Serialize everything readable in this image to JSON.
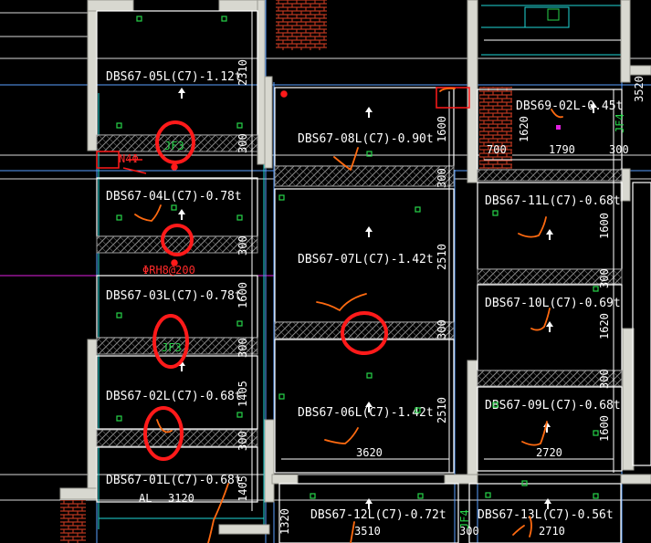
{
  "colors": {
    "background": "#000000",
    "wall": "#d8d8d0",
    "wall_inner": "#2b2b2b",
    "grid_line": "#ffffff",
    "axis_blue": "#5aa0ff",
    "cyan": "#20d8d8",
    "green_marker": "#27d44a",
    "hatch": "#8a8a8a",
    "brick": "#b8361f",
    "markup_red": "#ff1a1a",
    "markup_orange": "#ff6a10",
    "magenta": "#e020e0"
  },
  "slabs": [
    {
      "id": "s05",
      "label": "DBS67-05L(C7)-1.12t"
    },
    {
      "id": "s04",
      "label": "DBS67-04L(C7)-0.78t"
    },
    {
      "id": "s03",
      "label": "DBS67-03L(C7)-0.78t"
    },
    {
      "id": "s02",
      "label": "DBS67-02L(C7)-0.68t"
    },
    {
      "id": "s01",
      "label": "DBS67-01L(C7)-0.68t"
    },
    {
      "id": "s08",
      "label": "DBS67-08L(C7)-0.90t"
    },
    {
      "id": "s07",
      "label": "DBS67-07L(C7)-1.42t"
    },
    {
      "id": "s06",
      "label": "DBS67-06L(C7)-1.42t"
    },
    {
      "id": "s69",
      "label": "DBS69-02L-0.45t"
    },
    {
      "id": "s11",
      "label": "DBS67-11L(C7)-0.68t"
    },
    {
      "id": "s10",
      "label": "DBS67-10L(C7)-0.69t"
    },
    {
      "id": "s09",
      "label": "DBS67-09L(C7)-0.68t"
    },
    {
      "id": "s12",
      "label": "DBS67-12L(C7)-0.72t"
    },
    {
      "id": "s13",
      "label": "DBS67-13L(C7)-0.56t"
    }
  ],
  "dimensions": {
    "d2310": "2310",
    "d300a": "300",
    "d300b": "300",
    "d1600a": "1600",
    "d300c": "300",
    "d1405a": "1405",
    "d300d": "300",
    "d1405b": "1405",
    "d1600b": "1600",
    "d300e": "300",
    "d2510a": "2510",
    "d300f": "300",
    "d2510b": "2510",
    "d3620": "3620",
    "d3120": "3120",
    "d1620a": "1620",
    "d700": "700",
    "d1790": "1790",
    "d300g": "300",
    "d3520": "3520",
    "d1600c": "1600",
    "d300h": "300",
    "d1620b": "1620",
    "d300i": "300",
    "d1600d": "1600",
    "d2720": "2720",
    "d3510": "3510",
    "d2710": "2710",
    "d1320": "1320",
    "d300j": "300"
  },
  "annotations": {
    "jf3_a": "JF3",
    "jf3_b": "JF3",
    "jf4_a": "JF4",
    "jf4_b": "JF4",
    "rebar": "ΦRH8@200",
    "al": "AL",
    "nphi": "N4Φ"
  }
}
